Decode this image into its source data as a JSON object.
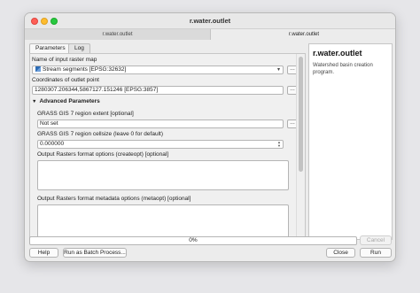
{
  "window": {
    "title": "r.water.outlet",
    "doc_tabs": [
      "r.water.outlet",
      "r.water.outlet"
    ]
  },
  "tabs": {
    "parameters": "Parameters",
    "log": "Log"
  },
  "form": {
    "input_raster_label": "Name of input raster map",
    "input_raster_value": "Stream segments [EPSG:32632]",
    "coords_label": "Coordinates of outlet point",
    "coords_value": "1280307.206344,5867127.151246 [EPSG:3857]",
    "dots": "…",
    "advanced_header": "Advanced Parameters",
    "region_extent_label": "GRASS GIS 7 region extent [optional]",
    "region_extent_value": "Not set",
    "cellsize_label": "GRASS GIS 7 region cellsize (leave 0 for default)",
    "cellsize_value": "0.000000",
    "createopt_label": "Output Rasters format options (createopt) [optional]",
    "metaopt_label": "Output Rasters format metadata options (metaopt) [optional]"
  },
  "help": {
    "title": "r.water.outlet",
    "description": "Watershed basin creation program."
  },
  "progress": {
    "text": "0%",
    "value": 0
  },
  "buttons": {
    "cancel": "Cancel",
    "help": "Help",
    "batch": "Run as Batch Process...",
    "close": "Close",
    "run": "Run"
  }
}
